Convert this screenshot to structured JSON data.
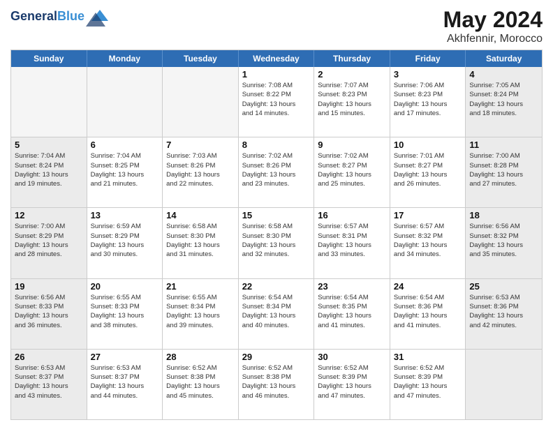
{
  "header": {
    "logo_line1": "General",
    "logo_line2": "Blue",
    "main_title": "May 2024",
    "subtitle": "Akhfennir, Morocco"
  },
  "weekdays": [
    "Sunday",
    "Monday",
    "Tuesday",
    "Wednesday",
    "Thursday",
    "Friday",
    "Saturday"
  ],
  "rows": [
    [
      {
        "day": "",
        "info": "",
        "empty": true
      },
      {
        "day": "",
        "info": "",
        "empty": true
      },
      {
        "day": "",
        "info": "",
        "empty": true
      },
      {
        "day": "1",
        "info": "Sunrise: 7:08 AM\nSunset: 8:22 PM\nDaylight: 13 hours\nand 14 minutes.",
        "empty": false
      },
      {
        "day": "2",
        "info": "Sunrise: 7:07 AM\nSunset: 8:23 PM\nDaylight: 13 hours\nand 15 minutes.",
        "empty": false
      },
      {
        "day": "3",
        "info": "Sunrise: 7:06 AM\nSunset: 8:23 PM\nDaylight: 13 hours\nand 17 minutes.",
        "empty": false
      },
      {
        "day": "4",
        "info": "Sunrise: 7:05 AM\nSunset: 8:24 PM\nDaylight: 13 hours\nand 18 minutes.",
        "empty": false,
        "shaded": true
      }
    ],
    [
      {
        "day": "5",
        "info": "Sunrise: 7:04 AM\nSunset: 8:24 PM\nDaylight: 13 hours\nand 19 minutes.",
        "shaded": true
      },
      {
        "day": "6",
        "info": "Sunrise: 7:04 AM\nSunset: 8:25 PM\nDaylight: 13 hours\nand 21 minutes."
      },
      {
        "day": "7",
        "info": "Sunrise: 7:03 AM\nSunset: 8:26 PM\nDaylight: 13 hours\nand 22 minutes."
      },
      {
        "day": "8",
        "info": "Sunrise: 7:02 AM\nSunset: 8:26 PM\nDaylight: 13 hours\nand 23 minutes."
      },
      {
        "day": "9",
        "info": "Sunrise: 7:02 AM\nSunset: 8:27 PM\nDaylight: 13 hours\nand 25 minutes."
      },
      {
        "day": "10",
        "info": "Sunrise: 7:01 AM\nSunset: 8:27 PM\nDaylight: 13 hours\nand 26 minutes."
      },
      {
        "day": "11",
        "info": "Sunrise: 7:00 AM\nSunset: 8:28 PM\nDaylight: 13 hours\nand 27 minutes.",
        "shaded": true
      }
    ],
    [
      {
        "day": "12",
        "info": "Sunrise: 7:00 AM\nSunset: 8:29 PM\nDaylight: 13 hours\nand 28 minutes.",
        "shaded": true
      },
      {
        "day": "13",
        "info": "Sunrise: 6:59 AM\nSunset: 8:29 PM\nDaylight: 13 hours\nand 30 minutes."
      },
      {
        "day": "14",
        "info": "Sunrise: 6:58 AM\nSunset: 8:30 PM\nDaylight: 13 hours\nand 31 minutes."
      },
      {
        "day": "15",
        "info": "Sunrise: 6:58 AM\nSunset: 8:30 PM\nDaylight: 13 hours\nand 32 minutes."
      },
      {
        "day": "16",
        "info": "Sunrise: 6:57 AM\nSunset: 8:31 PM\nDaylight: 13 hours\nand 33 minutes."
      },
      {
        "day": "17",
        "info": "Sunrise: 6:57 AM\nSunset: 8:32 PM\nDaylight: 13 hours\nand 34 minutes."
      },
      {
        "day": "18",
        "info": "Sunrise: 6:56 AM\nSunset: 8:32 PM\nDaylight: 13 hours\nand 35 minutes.",
        "shaded": true
      }
    ],
    [
      {
        "day": "19",
        "info": "Sunrise: 6:56 AM\nSunset: 8:33 PM\nDaylight: 13 hours\nand 36 minutes.",
        "shaded": true
      },
      {
        "day": "20",
        "info": "Sunrise: 6:55 AM\nSunset: 8:33 PM\nDaylight: 13 hours\nand 38 minutes."
      },
      {
        "day": "21",
        "info": "Sunrise: 6:55 AM\nSunset: 8:34 PM\nDaylight: 13 hours\nand 39 minutes."
      },
      {
        "day": "22",
        "info": "Sunrise: 6:54 AM\nSunset: 8:34 PM\nDaylight: 13 hours\nand 40 minutes."
      },
      {
        "day": "23",
        "info": "Sunrise: 6:54 AM\nSunset: 8:35 PM\nDaylight: 13 hours\nand 41 minutes."
      },
      {
        "day": "24",
        "info": "Sunrise: 6:54 AM\nSunset: 8:36 PM\nDaylight: 13 hours\nand 41 minutes."
      },
      {
        "day": "25",
        "info": "Sunrise: 6:53 AM\nSunset: 8:36 PM\nDaylight: 13 hours\nand 42 minutes.",
        "shaded": true
      }
    ],
    [
      {
        "day": "26",
        "info": "Sunrise: 6:53 AM\nSunset: 8:37 PM\nDaylight: 13 hours\nand 43 minutes.",
        "shaded": true
      },
      {
        "day": "27",
        "info": "Sunrise: 6:53 AM\nSunset: 8:37 PM\nDaylight: 13 hours\nand 44 minutes."
      },
      {
        "day": "28",
        "info": "Sunrise: 6:52 AM\nSunset: 8:38 PM\nDaylight: 13 hours\nand 45 minutes."
      },
      {
        "day": "29",
        "info": "Sunrise: 6:52 AM\nSunset: 8:38 PM\nDaylight: 13 hours\nand 46 minutes."
      },
      {
        "day": "30",
        "info": "Sunrise: 6:52 AM\nSunset: 8:39 PM\nDaylight: 13 hours\nand 47 minutes."
      },
      {
        "day": "31",
        "info": "Sunrise: 6:52 AM\nSunset: 8:39 PM\nDaylight: 13 hours\nand 47 minutes."
      },
      {
        "day": "",
        "info": "",
        "empty": true,
        "shaded": true
      }
    ]
  ]
}
